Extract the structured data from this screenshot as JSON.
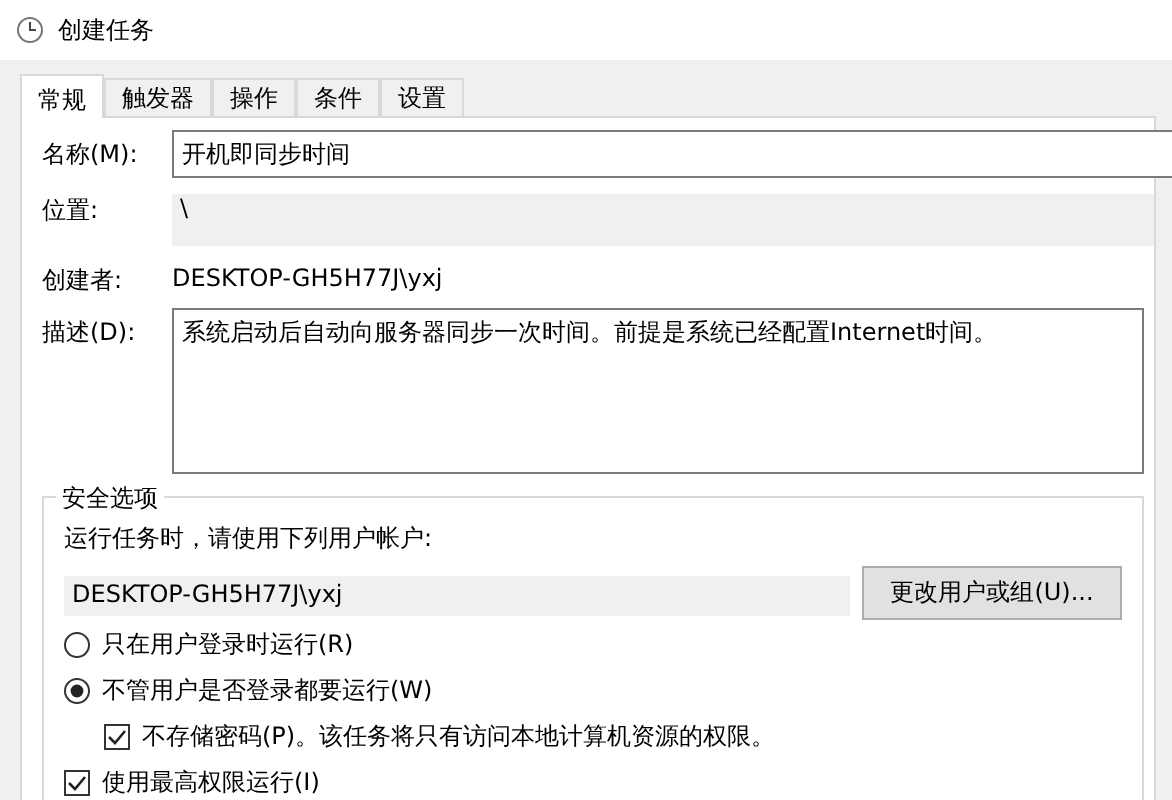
{
  "window": {
    "title": "创建任务"
  },
  "tabs": [
    {
      "label": "常规",
      "selected": true
    },
    {
      "label": "触发器",
      "selected": false
    },
    {
      "label": "操作",
      "selected": false
    },
    {
      "label": "条件",
      "selected": false
    },
    {
      "label": "设置",
      "selected": false
    }
  ],
  "name": {
    "label": "名称(M):",
    "value": "开机即同步时间"
  },
  "location": {
    "label": "位置:",
    "value": "\\"
  },
  "author": {
    "label": "创建者:",
    "value": "DESKTOP-GH5H77J\\yxj"
  },
  "description": {
    "label": "描述(D):",
    "value": "系统启动后自动向服务器同步一次时间。前提是系统已经配置Internet时间。"
  },
  "security": {
    "title": "安全选项",
    "prompt": "运行任务时，请使用下列用户帐户:",
    "account": "DESKTOP-GH5H77J\\yxj",
    "change_button": "更改用户或组(U)...",
    "options": [
      {
        "kind": "radio",
        "label": "只在用户登录时运行(R)",
        "selected": false,
        "indent": false
      },
      {
        "kind": "radio",
        "label": "不管用户是否登录都要运行(W)",
        "selected": true,
        "indent": false
      },
      {
        "kind": "checkbox",
        "label": "不存储密码(P)。该任务将只有访问本地计算机资源的权限。",
        "checked": true,
        "indent": true
      },
      {
        "kind": "checkbox",
        "label": "使用最高权限运行(I)",
        "checked": true,
        "indent": false
      }
    ]
  }
}
